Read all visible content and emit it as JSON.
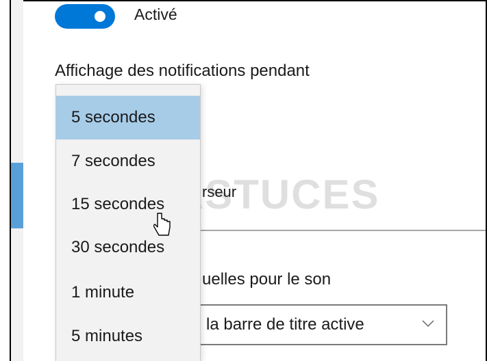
{
  "toggle": {
    "state_label": "Activé"
  },
  "notification_section": {
    "label": "Affichage des notifications pendant"
  },
  "dropdown": {
    "options": [
      "5 secondes",
      "7 secondes",
      "15 secondes",
      "30 secondes",
      "1 minute",
      "5 minutes"
    ],
    "selected": "5 secondes",
    "hovered": "15 secondes"
  },
  "background_text": {
    "cursor_fragment": "rseur",
    "visual_sound_fragment": "uelles pour le son"
  },
  "sound_select": {
    "value": "la barre de titre active"
  },
  "watermark": {
    "text": "PC ASTUCES"
  },
  "colors": {
    "accent": "#0078d7",
    "selected_item": "#a6cce8",
    "dropdown_bg": "#f2f2f2"
  }
}
